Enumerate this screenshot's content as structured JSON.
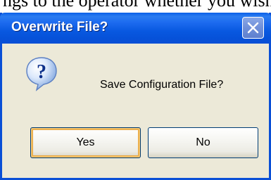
{
  "window": {
    "title": "Overwrite File?",
    "message": "Save Configuration File?"
  },
  "buttons": {
    "yes_label": "Yes",
    "no_label": "No"
  },
  "icons": {
    "dialog_icon": "question-icon",
    "close_icon": "close-icon"
  },
  "colors": {
    "titlebar": "#0a4fd6",
    "dialog_bg": "#ece9d8",
    "button_border": "#003c74",
    "default_focus": "#e8a53c"
  }
}
